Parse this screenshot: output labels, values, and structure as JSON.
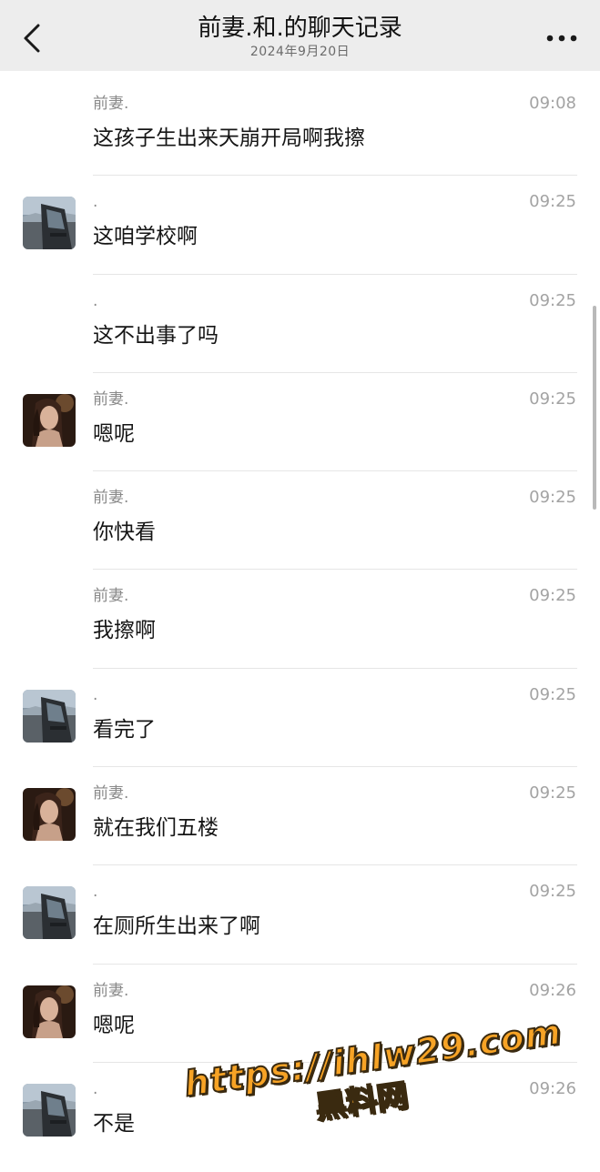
{
  "header": {
    "title": "前妻.和.的聊天记录",
    "date": "2024年9月20日",
    "back_icon": "chevron-left-icon",
    "more_icon": "more-dots-icon",
    "background": "#ededed"
  },
  "messages": [
    {
      "name": "前妻.",
      "time": "09:08",
      "text": "这孩子生出来天崩开局啊我擦",
      "avatar": ""
    },
    {
      "name": ".",
      "time": "09:25",
      "text": "这咱学校啊",
      "avatar": "car"
    },
    {
      "name": ".",
      "time": "09:25",
      "text": "这不出事了吗",
      "avatar": ""
    },
    {
      "name": "前妻.",
      "time": "09:25",
      "text": "嗯呢",
      "avatar": "woman"
    },
    {
      "name": "前妻.",
      "time": "09:25",
      "text": "你快看",
      "avatar": ""
    },
    {
      "name": "前妻.",
      "time": "09:25",
      "text": "我擦啊",
      "avatar": ""
    },
    {
      "name": ".",
      "time": "09:25",
      "text": "看完了",
      "avatar": "car"
    },
    {
      "name": "前妻.",
      "time": "09:25",
      "text": "就在我们五楼",
      "avatar": "woman"
    },
    {
      "name": ".",
      "time": "09:25",
      "text": "在厕所生出来了啊",
      "avatar": "car"
    },
    {
      "name": "前妻.",
      "time": "09:26",
      "text": "嗯呢",
      "avatar": "woman"
    },
    {
      "name": ".",
      "time": "09:26",
      "text": "不是",
      "avatar": "car"
    }
  ],
  "watermark": {
    "url": "https://ihlw29.com",
    "label": "黑料网",
    "color": "#f7a325"
  }
}
